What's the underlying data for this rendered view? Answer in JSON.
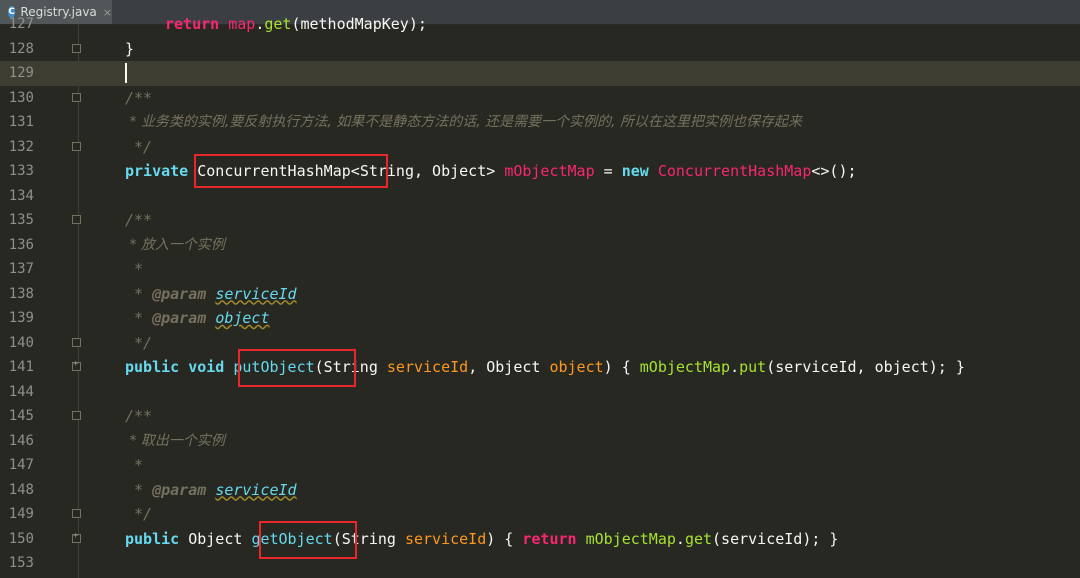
{
  "tab": {
    "title": "Registry.java",
    "icon": "java-class-icon",
    "icon_letter": "C",
    "close": "×"
  },
  "colors": {
    "background": "#272822",
    "highlight_box": "#e8272b",
    "current_line": "#3e3d32"
  },
  "lines": [
    {
      "num": "127",
      "text": "return map.get(methodMapKey);"
    },
    {
      "num": "128",
      "text": "}"
    },
    {
      "num": "129",
      "text": ""
    },
    {
      "num": "130",
      "text": "/**"
    },
    {
      "num": "131",
      "text": " * 业务类的实例,要反射执行方法, 如果不是静态方法的话, 还是需要一个实例的, 所以在这里把实例也保存起来"
    },
    {
      "num": "132",
      "text": " */"
    },
    {
      "num": "133",
      "text": "private ConcurrentHashMap<String, Object> mObjectMap = new ConcurrentHashMap<>();"
    },
    {
      "num": "134",
      "text": ""
    },
    {
      "num": "135",
      "text": "/**"
    },
    {
      "num": "136",
      "text": " * 放入一个实例"
    },
    {
      "num": "137",
      "text": " *"
    },
    {
      "num": "138",
      "text": " * @param serviceId"
    },
    {
      "num": "139",
      "text": " * @param object"
    },
    {
      "num": "140",
      "text": " */"
    },
    {
      "num": "141",
      "text": "public void putObject(String serviceId, Object object) { mObjectMap.put(serviceId, object); }"
    },
    {
      "num": "144",
      "text": ""
    },
    {
      "num": "145",
      "text": "/**"
    },
    {
      "num": "146",
      "text": " * 取出一个实例"
    },
    {
      "num": "147",
      "text": " *"
    },
    {
      "num": "148",
      "text": " * @param serviceId"
    },
    {
      "num": "149",
      "text": " */"
    },
    {
      "num": "150",
      "text": "public Object getObject(String serviceId) { return mObjectMap.get(serviceId); }"
    },
    {
      "num": "153",
      "text": ""
    }
  ],
  "tokens": {
    "ret": "return",
    "map": "map",
    "dot": ".",
    "get": "get",
    "mmk": "(methodMapKey);",
    "rbrace": "}",
    "cm_open": "/**",
    "cm_close": " */",
    "cm_star": " *",
    "cm_131": " * 业务类的实例,要反射执行方法, 如果不是静态方法的话, 还是需要一个实例的, 所以在这里把实例也保存起来",
    "cm_136": " * 放入一个实例",
    "cm_146": " * 取出一个实例",
    "cm_at": " * ",
    "param": "@param",
    "serviceId": "serviceId",
    "object_word": "object",
    "private": "private",
    "chm": "ConcurrentHashMap",
    "lt": "<",
    "string_obj": "String, Object> ",
    "mObjectMap": "mObjectMap",
    "eq": " = ",
    "new": "new",
    "chm_end": "<>();",
    "public": "public",
    "void": "void",
    "putObject": "putObject",
    "put_params_open": "(String ",
    "comma_obj": ", Object ",
    "object_p": "object",
    "rparen_brace": ") { ",
    "put": "put",
    "put_args": "(serviceId, object); }",
    "Object": "Object",
    "getObject": "getObject",
    "get_params_open": "(String ",
    "get_rparen": ") { ",
    "get_m": "get",
    "get_args": "(serviceId); }"
  }
}
